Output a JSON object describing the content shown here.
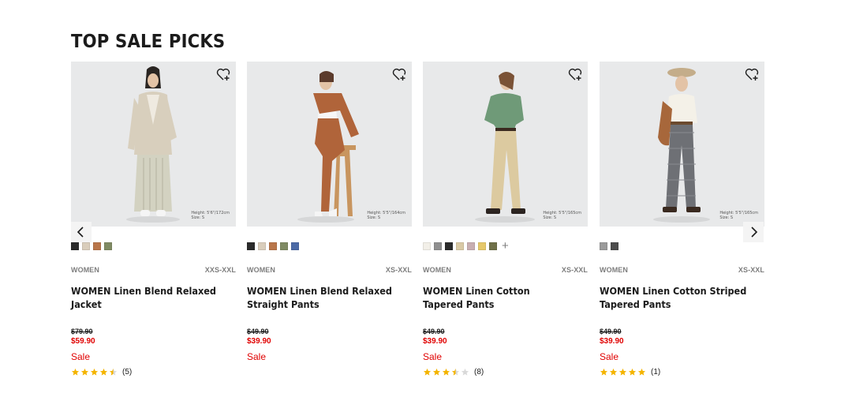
{
  "section": {
    "title": "TOP SALE PICKS"
  },
  "colors": {
    "sale": "#e00000",
    "star": "#f4b400",
    "text": "#1b1b1b",
    "muted": "#7d7d7d"
  },
  "icons": {
    "wishlist": "heart-plus-icon",
    "prev": "chevron-left-icon",
    "next": "chevron-right-icon",
    "more_colors": "plus-icon"
  },
  "products": [
    {
      "gender": "WOMEN",
      "sizes": "XXS-XXL",
      "name": "WOMEN Linen Blend Relaxed Jacket",
      "original_price": "$79.90",
      "sale_price": "$59.90",
      "flag": "Sale",
      "rating": 4.5,
      "review_count": "(5)",
      "model_height": "Height: 5'6\"/172cm",
      "model_size": "Size: S",
      "swatches": [
        "#2b2b2b",
        "#d9cdbb",
        "#b9764a",
        "#7f8a63"
      ],
      "more_colors": false
    },
    {
      "gender": "WOMEN",
      "sizes": "XS-XXL",
      "name": "WOMEN Linen Blend Relaxed Straight Pants",
      "original_price": "$49.90",
      "sale_price": "$39.90",
      "flag": "Sale",
      "rating": null,
      "review_count": "",
      "model_height": "Height: 5'5\"/164cm",
      "model_size": "Size: S",
      "swatches": [
        "#2b2b2b",
        "#d9cdbb",
        "#b9764a",
        "#7f8a63",
        "#4c6aa6"
      ],
      "more_colors": false
    },
    {
      "gender": "WOMEN",
      "sizes": "XS-XXL",
      "name": "WOMEN Linen Cotton Tapered Pants",
      "original_price": "$49.90",
      "sale_price": "$39.90",
      "flag": "Sale",
      "rating": 3.5,
      "review_count": "(8)",
      "model_height": "Height: 5'5\"/165cm",
      "model_size": "Size: S",
      "swatches": [
        "#f2efe8",
        "#8f8f8f",
        "#2b2b2b",
        "#d9c9a5",
        "#c8aeb1",
        "#e6c86a",
        "#6f7048"
      ],
      "more_colors": true
    },
    {
      "gender": "WOMEN",
      "sizes": "XS-XXL",
      "name": "WOMEN Linen Cotton Striped Tapered Pants",
      "original_price": "$49.90",
      "sale_price": "$39.90",
      "flag": "Sale",
      "rating": 5,
      "review_count": "(1)",
      "model_height": "Height: 5'5\"/165cm",
      "model_size": "Size: S",
      "swatches": [
        "#9a9a9a",
        "#4d4d4d"
      ],
      "more_colors": false
    }
  ]
}
